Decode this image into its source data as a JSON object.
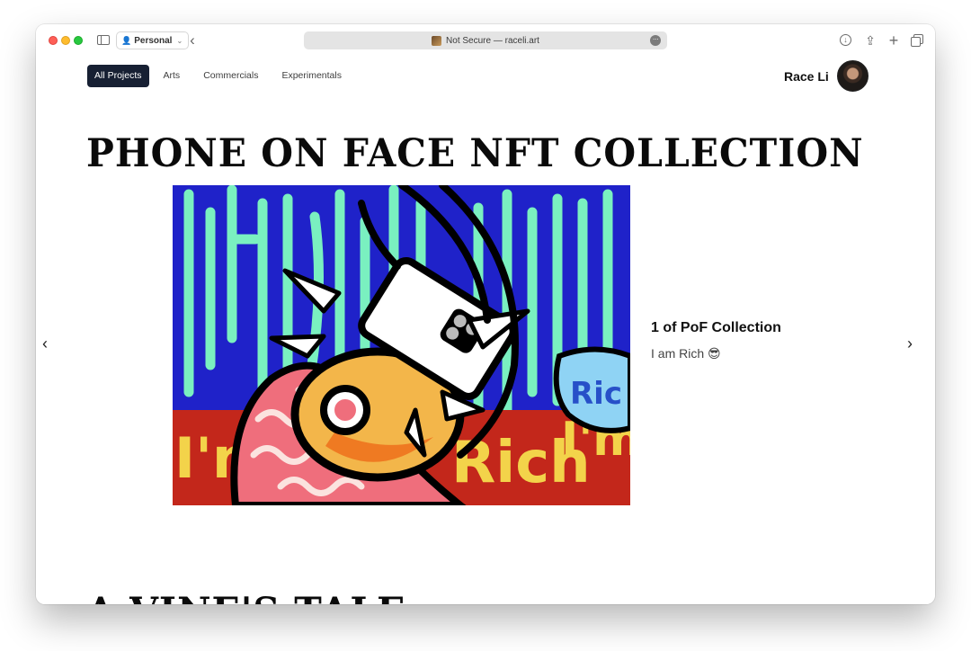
{
  "browser": {
    "profile": "Personal",
    "address": "Not Secure — raceli.art",
    "more": "···"
  },
  "nav": {
    "items": [
      "All Projects",
      "Arts",
      "Commercials",
      "Experimentals"
    ],
    "active": "All Projects"
  },
  "user": {
    "name": "Race Li"
  },
  "projects": [
    {
      "title": "PHONE ON FACE NFT COLLECTION",
      "slide": {
        "title": "1 of PoF Collection",
        "subtitle": "I am Rich 😎"
      },
      "artwork_text": [
        "I'm",
        "Rich",
        "I'm",
        "Ric"
      ]
    },
    {
      "title": "A VINE'S TALE"
    }
  ],
  "carousel": {
    "prev": "‹",
    "next": "›"
  },
  "colors": {
    "nav_active_bg": "#172033",
    "art_blue": "#1f22c9",
    "art_green": "#7af0c0",
    "art_red": "#c3271b",
    "art_yellow": "#f3d34a",
    "art_pink": "#ef6e7c"
  }
}
